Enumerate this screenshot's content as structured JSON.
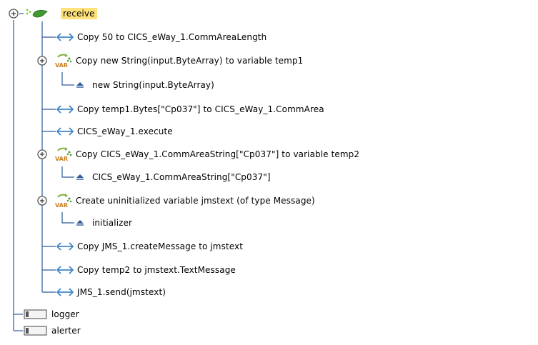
{
  "tree": {
    "root": {
      "label": "receive",
      "icon": "operation-icon"
    },
    "items": [
      {
        "label": "Copy 50 to CICS_eWay_1.CommAreaLength",
        "icon": "copy-arrow-icon"
      },
      {
        "label": "Copy new String(input.ByteArray) to variable temp1",
        "icon": "variable-icon"
      },
      {
        "label": "new String(input.ByteArray)",
        "icon": "triangle-up-icon"
      },
      {
        "label": "Copy temp1.Bytes[\"Cp037\"] to CICS_eWay_1.CommArea",
        "icon": "copy-arrow-icon"
      },
      {
        "label": "CICS_eWay_1.execute",
        "icon": "copy-arrow-icon"
      },
      {
        "label": "Copy CICS_eWay_1.CommAreaString[\"Cp037\"] to variable temp2",
        "icon": "variable-icon"
      },
      {
        "label": "CICS_eWay_1.CommAreaString[\"Cp037\"]",
        "icon": "triangle-up-icon"
      },
      {
        "label": "Create uninitialized variable jmstext (of type Message)",
        "icon": "variable-icon"
      },
      {
        "label": "initializer",
        "icon": "triangle-up-icon"
      },
      {
        "label": "Copy JMS_1.createMessage to jmstext",
        "icon": "copy-arrow-icon"
      },
      {
        "label": "Copy temp2 to jmstext.TextMessage",
        "icon": "copy-arrow-icon"
      },
      {
        "label": "JMS_1.send(jmstext)",
        "icon": "copy-arrow-icon"
      }
    ],
    "siblings": [
      {
        "label": "logger",
        "icon": "component-box-icon"
      },
      {
        "label": "alerter",
        "icon": "component-box-icon"
      }
    ],
    "var_badge": "VAR"
  },
  "colors": {
    "tree_line": "#2f5a9a",
    "root_highlight": "#ffe27a",
    "copy_icon": "#3f86c8",
    "var_icon": "#7fb23a",
    "var_text": "#c87d1a"
  }
}
